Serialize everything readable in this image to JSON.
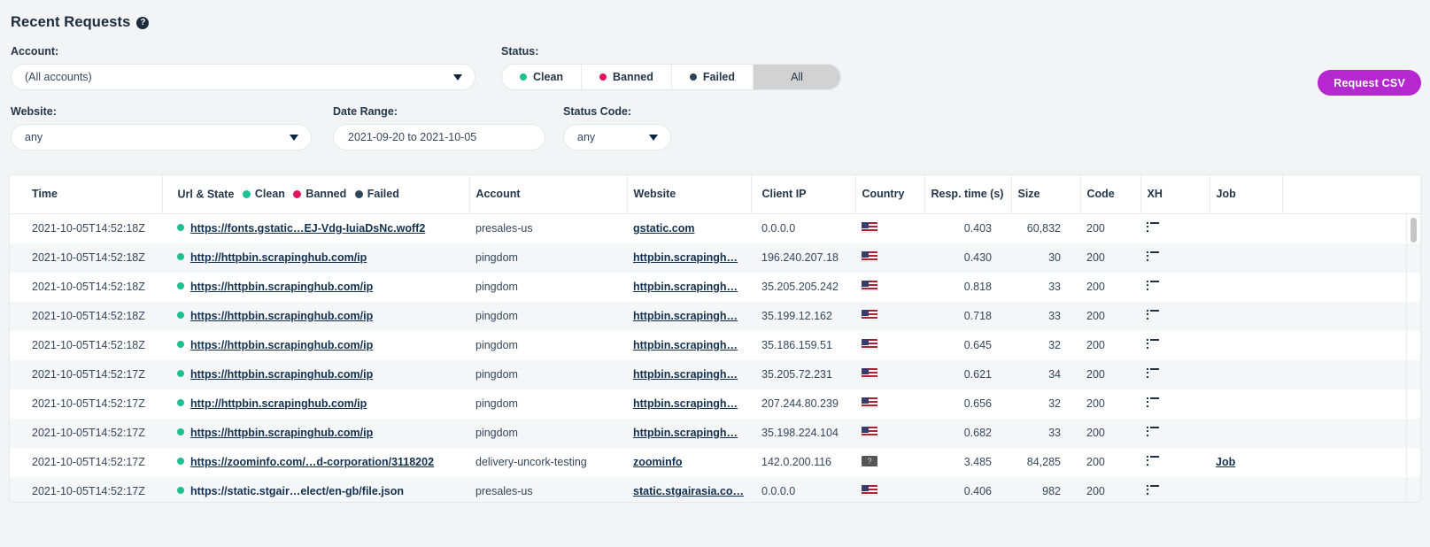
{
  "header": {
    "title": "Recent Requests",
    "help_icon": "help-circle-icon"
  },
  "filters": {
    "account": {
      "label": "Account:",
      "value": "(All accounts)"
    },
    "status": {
      "label": "Status:",
      "options": [
        {
          "label": "Clean",
          "color": "#1fbf92",
          "active": false
        },
        {
          "label": "Banned",
          "color": "#e3145f",
          "active": false
        },
        {
          "label": "Failed",
          "color": "#2e4458",
          "active": false
        },
        {
          "label": "All",
          "color": "",
          "active": true
        }
      ]
    },
    "website": {
      "label": "Website:",
      "value": "any"
    },
    "date_range": {
      "label": "Date Range:",
      "value": "2021-09-20 to 2021-10-05"
    },
    "status_code": {
      "label": "Status Code:",
      "value": "any"
    }
  },
  "actions": {
    "request_csv": "Request CSV",
    "accent_color": "#b628cf"
  },
  "table": {
    "columns": {
      "time": "Time",
      "url_state": "Url & State",
      "legend": [
        {
          "label": "Clean",
          "color": "#1fbf92"
        },
        {
          "label": "Banned",
          "color": "#e3145f"
        },
        {
          "label": "Failed",
          "color": "#2e4458"
        }
      ],
      "account": "Account",
      "website": "Website",
      "client_ip": "Client IP",
      "country": "Country",
      "resp_time": "Resp. time (s)",
      "size": "Size",
      "code": "Code",
      "xh": "XH",
      "job": "Job"
    },
    "rows": [
      {
        "time": "2021-10-05T14:52:18Z",
        "state_color": "#1fbf92",
        "url": "https://fonts.gstatic…EJ-Vdg-IuiaDsNc.woff2",
        "url_link": true,
        "account": "presales-us",
        "website": "gstatic.com",
        "client_ip": "0.0.0.0",
        "country": "US",
        "resp_time": "0.403",
        "size": "60,832",
        "code": "200",
        "xh": "list-icon",
        "job": ""
      },
      {
        "time": "2021-10-05T14:52:18Z",
        "state_color": "#1fbf92",
        "url": "http://httpbin.scrapinghub.com/ip",
        "url_link": true,
        "account": "pingdom",
        "website": "httpbin.scrapingh…",
        "client_ip": "196.240.207.18",
        "country": "US",
        "resp_time": "0.430",
        "size": "30",
        "code": "200",
        "xh": "list-icon",
        "job": ""
      },
      {
        "time": "2021-10-05T14:52:18Z",
        "state_color": "#1fbf92",
        "url": "https://httpbin.scrapinghub.com/ip",
        "url_link": true,
        "account": "pingdom",
        "website": "httpbin.scrapingh…",
        "client_ip": "35.205.205.242",
        "country": "US",
        "resp_time": "0.818",
        "size": "33",
        "code": "200",
        "xh": "list-icon",
        "job": ""
      },
      {
        "time": "2021-10-05T14:52:18Z",
        "state_color": "#1fbf92",
        "url": "https://httpbin.scrapinghub.com/ip",
        "url_link": true,
        "account": "pingdom",
        "website": "httpbin.scrapingh…",
        "client_ip": "35.199.12.162",
        "country": "US",
        "resp_time": "0.718",
        "size": "33",
        "code": "200",
        "xh": "list-icon",
        "job": ""
      },
      {
        "time": "2021-10-05T14:52:18Z",
        "state_color": "#1fbf92",
        "url": "https://httpbin.scrapinghub.com/ip",
        "url_link": true,
        "account": "pingdom",
        "website": "httpbin.scrapingh…",
        "client_ip": "35.186.159.51",
        "country": "US",
        "resp_time": "0.645",
        "size": "32",
        "code": "200",
        "xh": "list-icon",
        "job": ""
      },
      {
        "time": "2021-10-05T14:52:17Z",
        "state_color": "#1fbf92",
        "url": "https://httpbin.scrapinghub.com/ip",
        "url_link": true,
        "account": "pingdom",
        "website": "httpbin.scrapingh…",
        "client_ip": "35.205.72.231",
        "country": "US",
        "resp_time": "0.621",
        "size": "34",
        "code": "200",
        "xh": "list-icon",
        "job": ""
      },
      {
        "time": "2021-10-05T14:52:17Z",
        "state_color": "#1fbf92",
        "url": "http://httpbin.scrapinghub.com/ip",
        "url_link": true,
        "account": "pingdom",
        "website": "httpbin.scrapingh…",
        "client_ip": "207.244.80.239",
        "country": "US",
        "resp_time": "0.656",
        "size": "32",
        "code": "200",
        "xh": "list-icon",
        "job": ""
      },
      {
        "time": "2021-10-05T14:52:17Z",
        "state_color": "#1fbf92",
        "url": "https://httpbin.scrapinghub.com/ip",
        "url_link": true,
        "account": "pingdom",
        "website": "httpbin.scrapingh…",
        "client_ip": "35.198.224.104",
        "country": "US",
        "resp_time": "0.682",
        "size": "33",
        "code": "200",
        "xh": "list-icon",
        "job": ""
      },
      {
        "time": "2021-10-05T14:52:17Z",
        "state_color": "#1fbf92",
        "url": "https://zoominfo.com/…d-corporation/3118202",
        "url_link": true,
        "account": "delivery-uncork-testing",
        "website": "zoominfo",
        "client_ip": "142.0.200.116",
        "country": "unknown",
        "resp_time": "3.485",
        "size": "84,285",
        "code": "200",
        "xh": "list-icon",
        "job": "Job"
      },
      {
        "time": "2021-10-05T14:52:17Z",
        "state_color": "#1fbf92",
        "url": "https://static.stgair…elect/en-gb/file.json",
        "url_link": false,
        "account": "presales-us",
        "website": "static.stgairasia.co…",
        "client_ip": "0.0.0.0",
        "country": "US",
        "resp_time": "0.406",
        "size": "982",
        "code": "200",
        "xh": "list-icon",
        "job": ""
      }
    ]
  }
}
